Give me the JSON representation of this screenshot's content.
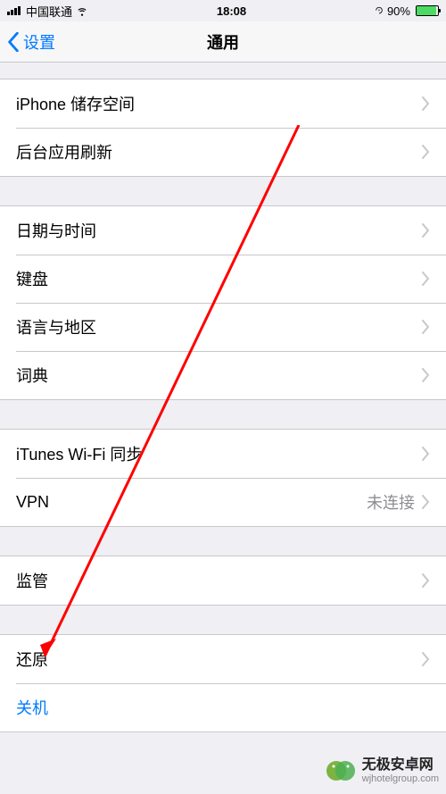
{
  "status": {
    "carrier": "中国联通",
    "time": "18:08",
    "battery_pct": "90%"
  },
  "nav": {
    "back_label": "设置",
    "title": "通用"
  },
  "groups": [
    {
      "rows": [
        {
          "label": "iPhone 储存空间"
        },
        {
          "label": "后台应用刷新"
        }
      ]
    },
    {
      "rows": [
        {
          "label": "日期与时间"
        },
        {
          "label": "键盘"
        },
        {
          "label": "语言与地区"
        },
        {
          "label": "词典"
        }
      ]
    },
    {
      "rows": [
        {
          "label": "iTunes Wi-Fi 同步"
        },
        {
          "label": "VPN",
          "detail": "未连接"
        }
      ]
    },
    {
      "rows": [
        {
          "label": "监管"
        }
      ]
    },
    {
      "rows": [
        {
          "label": "还原"
        },
        {
          "label": "关机",
          "link": true
        }
      ]
    }
  ],
  "watermark": {
    "site": "无极安卓网",
    "url": "wjhotelgroup.com"
  },
  "colors": {
    "accent": "#007aff",
    "arrow": "#ff0000",
    "battery": "#4cd964"
  }
}
